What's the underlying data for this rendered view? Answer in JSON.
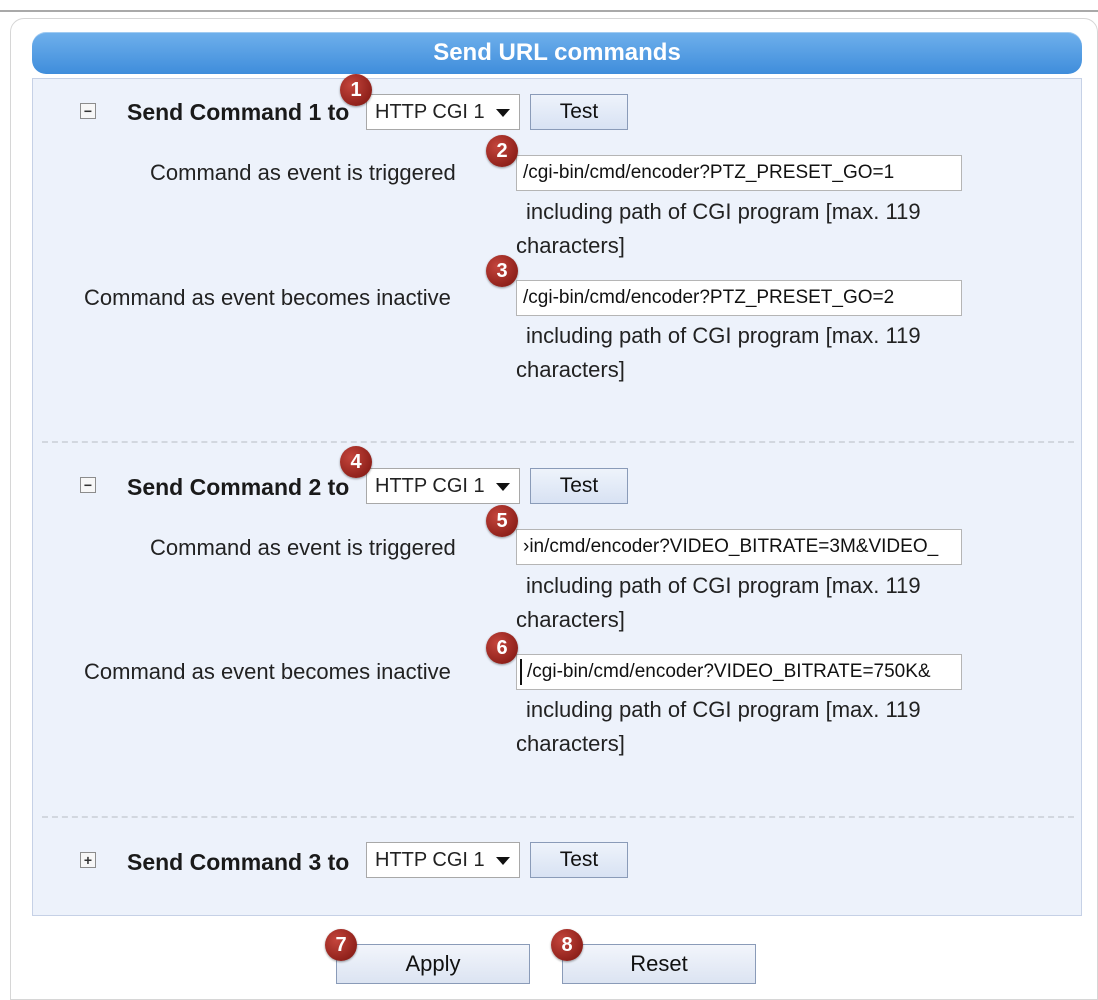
{
  "title": "Send URL commands",
  "commands": [
    {
      "toggle": "−",
      "label": "Send Command 1 to",
      "target": "HTTP CGI 1",
      "test_label": "Test",
      "triggered_label": "Command as event is triggered",
      "triggered_value": "/cgi-bin/cmd/encoder?PTZ_PRESET_GO=1",
      "inactive_label": "Command as event becomes inactive",
      "inactive_value": "/cgi-bin/cmd/encoder?PTZ_PRESET_GO=2",
      "help": "including path of CGI program [max. 119 characters]"
    },
    {
      "toggle": "−",
      "label": "Send Command 2 to",
      "target": "HTTP CGI 1",
      "test_label": "Test",
      "triggered_label": "Command as event is triggered",
      "triggered_value": "›in/cmd/encoder?VIDEO_BITRATE=3M&VIDEO_",
      "inactive_label": "Command as event becomes inactive",
      "inactive_value": "/cgi-bin/cmd/encoder?VIDEO_BITRATE=750K&",
      "help": "including path of CGI program [max. 119 characters]"
    },
    {
      "toggle": "+",
      "label": "Send Command 3 to",
      "target": "HTTP CGI 1",
      "test_label": "Test"
    }
  ],
  "apply_label": "Apply",
  "reset_label": "Reset",
  "badges": [
    "1",
    "2",
    "3",
    "4",
    "5",
    "6",
    "7",
    "8"
  ],
  "badge_color": "#9b1c15",
  "header_color": "#4a94de"
}
